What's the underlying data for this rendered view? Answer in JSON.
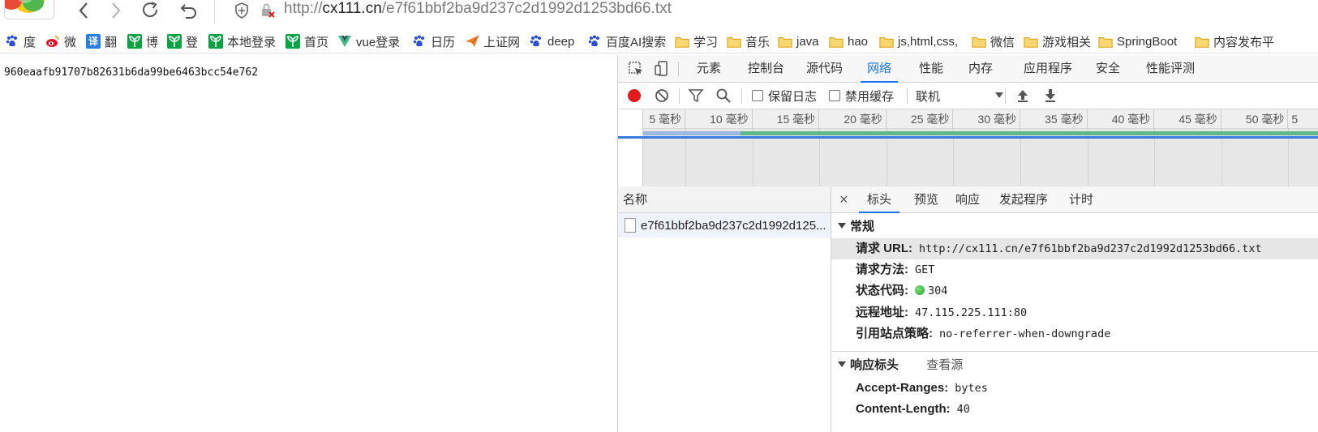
{
  "address_bar": {
    "url_prefix": "http://",
    "url_host": "cx111.cn",
    "url_path": "/e7f61bbf2ba9d237c2d1992d1253bd66.txt"
  },
  "bookmarks": [
    {
      "label": "度",
      "icon": "baidu-paw-icon"
    },
    {
      "label": "微",
      "icon": "weibo-icon"
    },
    {
      "label": "翻",
      "icon": "translate-icon",
      "icon_text": "译"
    },
    {
      "label": "博",
      "icon": "sprout-icon"
    },
    {
      "label": "登",
      "icon": "sprout-icon"
    },
    {
      "label": "本地登录",
      "icon": "sprout-icon"
    },
    {
      "label": "首页",
      "icon": "sprout-icon"
    },
    {
      "label": "vue登录",
      "icon": "vue-icon"
    },
    {
      "label": "日历",
      "icon": "baidu-paw-icon"
    },
    {
      "label": "上证网",
      "icon": "paper-plane-icon"
    },
    {
      "label": "deep",
      "icon": "baidu-paw-icon"
    },
    {
      "label": "百度AI搜索",
      "icon": "baidu-paw-icon"
    },
    {
      "label": "学习",
      "icon": "folder-icon"
    },
    {
      "label": "音乐",
      "icon": "folder-icon"
    },
    {
      "label": "java",
      "icon": "folder-icon"
    },
    {
      "label": "hao",
      "icon": "folder-icon"
    },
    {
      "label": "js,html,css,",
      "icon": "folder-icon"
    },
    {
      "label": "微信",
      "icon": "folder-icon"
    },
    {
      "label": "游戏相关",
      "icon": "folder-icon"
    },
    {
      "label": "SpringBoot",
      "icon": "folder-icon"
    },
    {
      "label": "内容发布平",
      "icon": "folder-icon"
    }
  ],
  "page": {
    "content": "960eaafb91707b82631b6da99be6463bcc54e762"
  },
  "devtools": {
    "tabs": [
      "元素",
      "控制台",
      "源代码",
      "网络",
      "性能",
      "内存",
      "应用程序",
      "安全",
      "性能评测"
    ],
    "active_tab": "网络",
    "toolbar": {
      "preserve_log": "保留日志",
      "disable_cache": "禁用缓存",
      "throttle": "联机"
    },
    "timeline_ticks": [
      "5 毫秒",
      "10 毫秒",
      "15 毫秒",
      "20 毫秒",
      "25 毫秒",
      "30 毫秒",
      "35 毫秒",
      "40 毫秒",
      "45 毫秒",
      "50 毫秒",
      "5"
    ],
    "names_header": "名称",
    "request_name": "e7f61bbf2ba9d237c2d1992d125...",
    "detail_tabs": [
      "标头",
      "预览",
      "响应",
      "发起程序",
      "计时"
    ],
    "active_detail_tab": "标头",
    "general": {
      "title": "常规",
      "request_url_label": "请求 URL:",
      "request_url": "http://cx111.cn/e7f61bbf2ba9d237c2d1992d1253bd66.txt",
      "method_label": "请求方法:",
      "method": "GET",
      "status_label": "状态代码:",
      "status": "304",
      "remote_label": "远程地址:",
      "remote": "47.115.225.111:80",
      "referrer_label": "引用站点策略:",
      "referrer": "no-referrer-when-downgrade"
    },
    "response_headers": {
      "title": "响应标头",
      "view_source": "查看源",
      "accept_ranges_label": "Accept-Ranges:",
      "accept_ranges": "bytes",
      "content_length_label": "Content-Length:",
      "content_length": "40"
    }
  },
  "colors": {
    "accent": "#1a73e8",
    "record": "#e01b1b",
    "status_ok": "#1ea51e",
    "folder": "#f5c64b"
  }
}
